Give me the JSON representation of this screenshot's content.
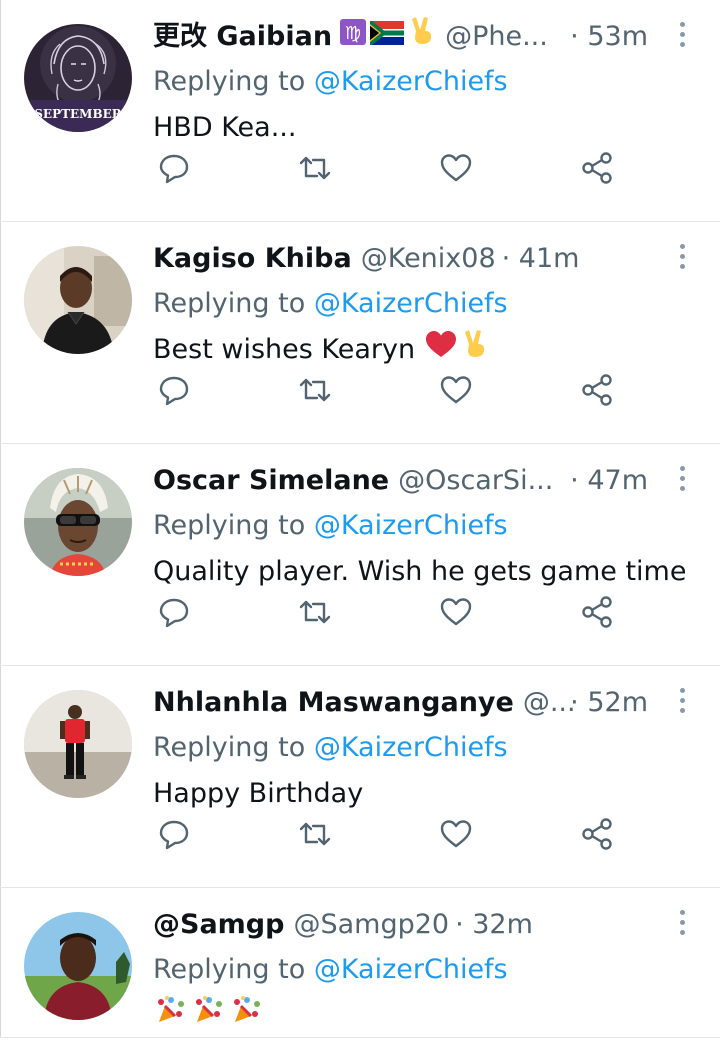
{
  "reply_prefix": "Replying to",
  "icons": {
    "reply": "reply-icon",
    "retweet": "retweet-icon",
    "like": "heart-icon",
    "share": "share-icon",
    "more": "more-vertical-icon"
  },
  "colors": {
    "name": "#0f1419",
    "secondary": "#536471",
    "link": "#1d9bf0",
    "divider": "#e6e6e6"
  },
  "tweets": [
    {
      "name": "更改 Gaibian",
      "name_emojis": [
        "virgo-emoji",
        "south-africa-flag-emoji",
        "victory-hand-emoji"
      ],
      "handle": "@Phe...",
      "time": "· 53m",
      "reply_to": "@KaizerChiefs",
      "text": "HBD Kea...",
      "avatar_label": "SEPTEMBER"
    },
    {
      "name": "Kagiso Khiba",
      "handle": "@Kenix08",
      "time": "· 41m",
      "reply_to": "@KaizerChiefs",
      "text": "Best wishes Kearyn",
      "text_emojis": [
        "red-heart-emoji",
        "victory-hand-emoji"
      ]
    },
    {
      "name": "Oscar Simelane",
      "handle": "@OscarSi...",
      "time": "· 47m",
      "reply_to": "@KaizerChiefs",
      "text": "Quality player. Wish he gets game time"
    },
    {
      "name": "Nhlanhla Maswanganye",
      "handle": "@...",
      "time": "· 52m",
      "reply_to": "@KaizerChiefs",
      "text": "Happy Birthday"
    },
    {
      "name": "@Samgp",
      "handle": "@Samgp20",
      "time": "· 32m",
      "reply_to": "@KaizerChiefs",
      "text": "",
      "text_emojis": [
        "party-popper-emoji",
        "party-popper-emoji",
        "party-popper-emoji"
      ]
    }
  ]
}
